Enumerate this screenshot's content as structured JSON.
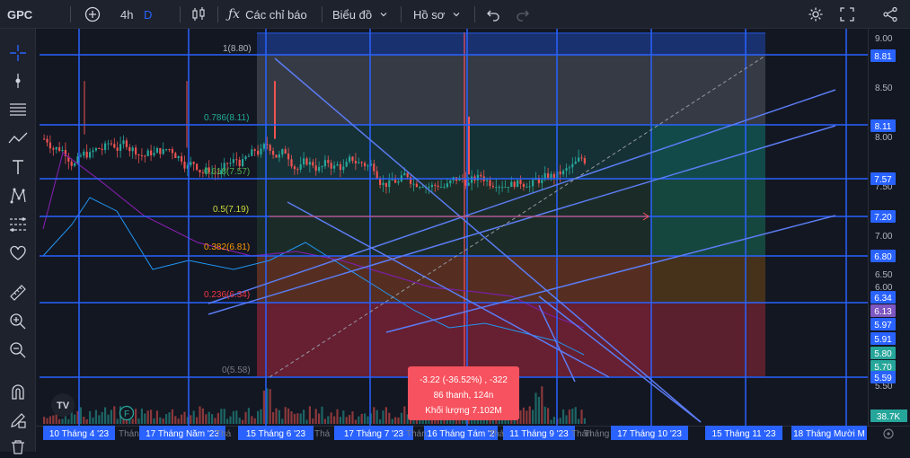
{
  "toolbar": {
    "symbol": "GPC",
    "interval": "4h",
    "interval_extra": "D",
    "indicators_label": "Các chỉ báo",
    "chart_menu_label": "Biểu đồ",
    "profile_menu_label": "Hồ sơ"
  },
  "colors": {
    "background": "#131722",
    "panel": "#1e222d",
    "up": "#26a69a",
    "down": "#ef5350",
    "drawing_lines": "#2962ff",
    "tooltip_bg": "#f7525f"
  },
  "left_tools": [
    "crosshair-icon",
    "cursor-dot-icon",
    "horizontal-lines-icon",
    "trendline-icon",
    "text-icon",
    "pattern-icon",
    "fib-icon",
    "heart-icon",
    "ruler-icon",
    "zoom-in-icon",
    "zoom-out-icon",
    "magnet-icon",
    "lock-draw-icon",
    "trash-icon"
  ],
  "fib_levels": [
    {
      "label": "1(8.80)",
      "color": "#b2b5be"
    },
    {
      "label": "0.786(8.11)",
      "color": "#22ab94"
    },
    {
      "label": "0.618(7.57)",
      "color": "#4caf50"
    },
    {
      "label": "0.5(7.19)",
      "color": "#cddc39"
    },
    {
      "label": "0.382(6.81)",
      "color": "#ff9800"
    },
    {
      "label": "0.236(6.34)",
      "color": "#f23645"
    },
    {
      "label": "0(5.58)",
      "color": "#787b86"
    }
  ],
  "price_axis": {
    "ticks": [
      "9.00",
      "8.50",
      "8.00",
      "7.50",
      "7.00",
      "6.50",
      "6.00",
      "5.50"
    ],
    "badges": [
      {
        "text": "8.81",
        "color": "#2962ff"
      },
      {
        "text": "8.11",
        "color": "#2962ff"
      },
      {
        "text": "7.57",
        "color": "#2962ff"
      },
      {
        "text": "7.20",
        "color": "#2962ff"
      },
      {
        "text": "6.80",
        "color": "#2962ff"
      },
      {
        "text": "6.34",
        "color": "#2962ff"
      },
      {
        "text": "6.13",
        "color": "#7e57c2"
      },
      {
        "text": "5.97",
        "color": "#2962ff"
      },
      {
        "text": "5.91",
        "color": "#2962ff"
      },
      {
        "text": "5.80",
        "color": "#26a69a"
      },
      {
        "text": "5.70",
        "color": "#26a69a"
      },
      {
        "text": "5.59",
        "color": "#2962ff"
      }
    ],
    "volume_badge": "38.7K"
  },
  "time_axis": {
    "highlighted": [
      "10 Tháng 4 '23",
      "17 Tháng Năm '23",
      "15 Tháng 6 '23",
      "17 Tháng 7 '23",
      "16 Tháng Tám '2",
      "11 Tháng 9 '23",
      "17 Tháng 10 '23",
      "15 Tháng 11 '23",
      "18 Tháng Mười M"
    ],
    "plain": [
      "Thán",
      "Thá",
      "Thá",
      "Thán",
      "Thá",
      "Thán",
      "Tháng"
    ]
  },
  "tooltip": {
    "line1": "-3.22 (-36.52%) , -322",
    "line2": "86 thanh, 124n",
    "line3": "Khối lượng 7.102M"
  },
  "logo_text": "TV",
  "earnings_badge": "F"
}
